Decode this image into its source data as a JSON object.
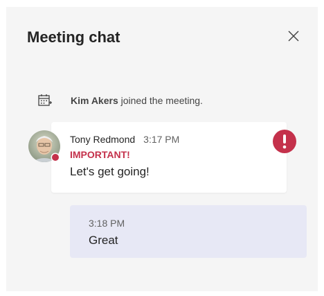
{
  "header": {
    "title": "Meeting chat"
  },
  "system_message": {
    "user": "Kim Akers",
    "text": "joined the meeting."
  },
  "messages": [
    {
      "sender": "Tony Redmond",
      "time": "3:17 PM",
      "flag": "IMPORTANT!",
      "text": "Let's get going!"
    },
    {
      "time": "3:18 PM",
      "text": "Great"
    }
  ],
  "colors": {
    "accent_important": "#c4314b",
    "own_bubble": "#e7e8f5",
    "panel": "#f5f5f5"
  },
  "icons": {
    "close": "close-icon",
    "calendar": "calendar-add-icon",
    "alert": "exclamation-icon"
  }
}
